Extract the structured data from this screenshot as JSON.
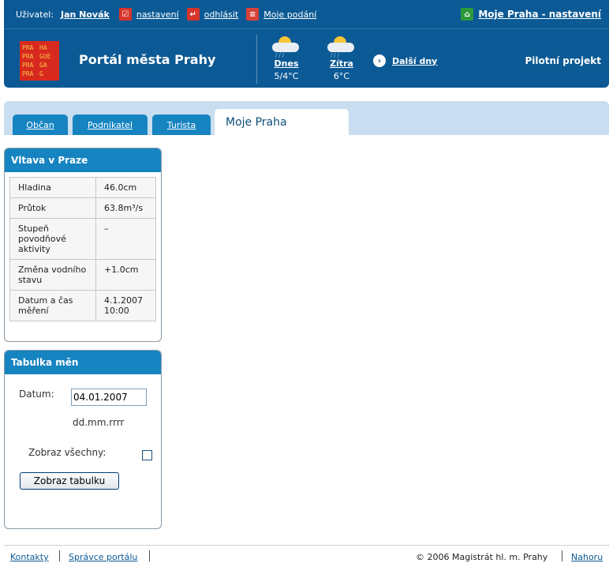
{
  "userbar": {
    "user_label": "Uživatel:",
    "user_name": "Jan Novák",
    "links": [
      {
        "label": "nastavení",
        "icon": "checklist-icon"
      },
      {
        "label": "odhlásit",
        "icon": "logout-icon"
      },
      {
        "label": "Moje podání",
        "icon": "form-icon"
      }
    ],
    "right_link": "Moje Praha - nastavení",
    "right_icon": "home-icon"
  },
  "brand": {
    "logo_letters": [
      "PRA",
      "HA",
      "PRA",
      "GUE",
      "PRA",
      "GA",
      "PRA",
      "G"
    ],
    "title": "Portál města Prahy",
    "pilot": "Pilotní projekt"
  },
  "weather": {
    "today": {
      "day": "Dnes",
      "temp": "5/4°C"
    },
    "tomorrow": {
      "day": "Zítra",
      "temp": "6°C"
    },
    "next_days": "Další dny"
  },
  "tabs": [
    {
      "label": "Občan"
    },
    {
      "label": "Podnikatel"
    },
    {
      "label": "Turista"
    },
    {
      "label": "Moje Praha"
    }
  ],
  "vltava": {
    "title": "Vltava v Praze",
    "rows": [
      {
        "k": "Hladina",
        "v": "46.0cm"
      },
      {
        "k": "Průtok",
        "v": "63.8m³/s"
      },
      {
        "k": "Stupeň povodňové aktivity",
        "v": "–"
      },
      {
        "k": "Změna vodního stavu",
        "v": "+1.0cm"
      },
      {
        "k": "Datum a čas měření",
        "v": "4.1.2007 10:00"
      }
    ]
  },
  "exchange": {
    "title": "Tabulka měn",
    "date_label": "Datum:",
    "date_value": "04.01.2007",
    "date_format": "dd.mm.rrrr",
    "show_all_label": "Zobraz všechny:",
    "button": "Zobraz tabulku"
  },
  "footer": {
    "contacts": "Kontakty",
    "admin": "Správce portálu",
    "copyright": "© 2006 Magistrát hl. m. Prahy",
    "top": "Nahoru"
  },
  "colors": {
    "header": "#0c5a95",
    "tab": "#1684c0",
    "tabbar": "#c9def0",
    "logo": "#d8291f"
  }
}
